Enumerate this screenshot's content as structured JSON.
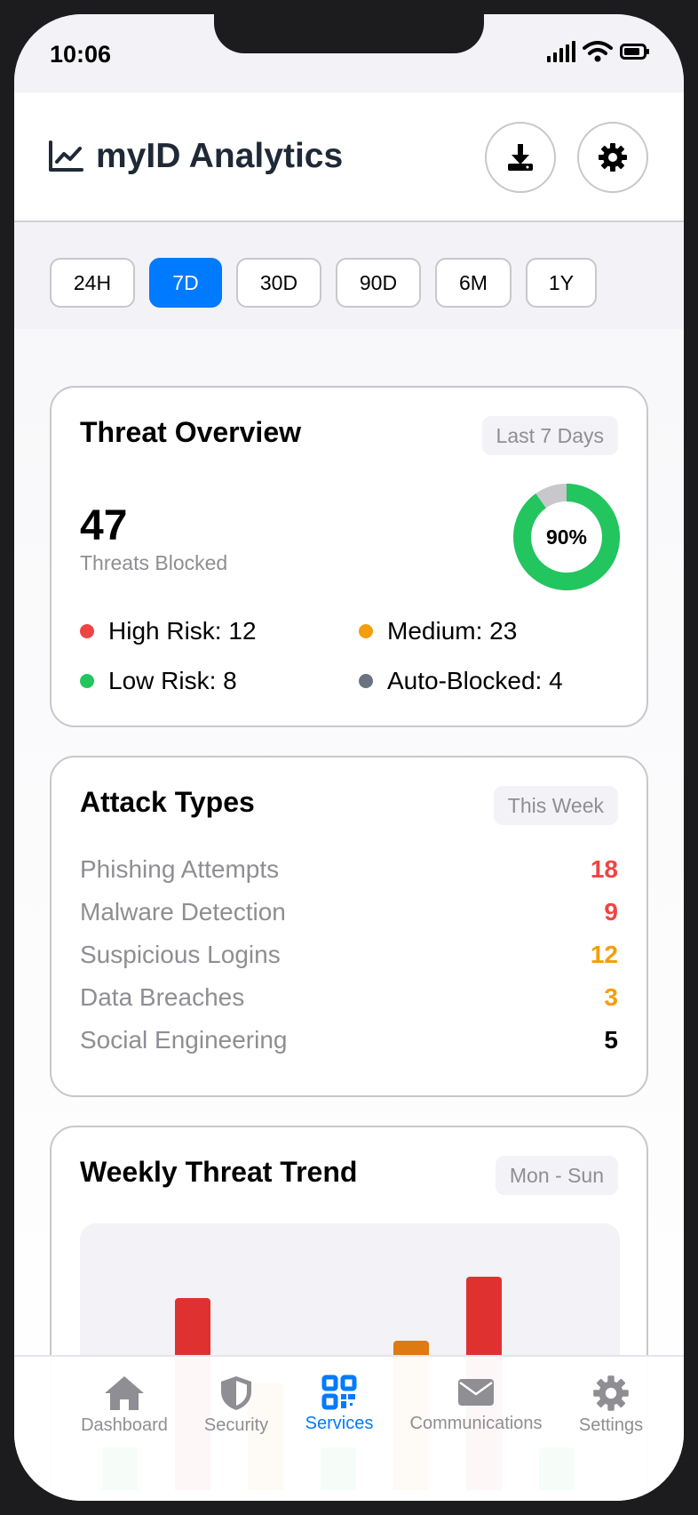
{
  "status_bar": {
    "time": "10:06"
  },
  "header": {
    "title": "myID Analytics"
  },
  "periods": [
    "24H",
    "7D",
    "30D",
    "90D",
    "6M",
    "1Y"
  ],
  "active_period": "7D",
  "threat_overview": {
    "title": "Threat Overview",
    "badge": "Last 7 Days",
    "count": "47",
    "count_label": "Threats Blocked",
    "percent_text": "90%",
    "percent_value": 0.9,
    "legend": [
      {
        "label": "High Risk: 12",
        "color": "#ef4444"
      },
      {
        "label": "Medium: 23",
        "color": "#f59e0b"
      },
      {
        "label": "Low Risk: 8",
        "color": "#22c55e"
      },
      {
        "label": "Auto-Blocked: 4",
        "color": "#6b7280"
      }
    ],
    "colors": {
      "ring": "#22c55e",
      "ring_track": "#c7c7cc"
    }
  },
  "attack_types": {
    "title": "Attack Types",
    "badge": "This Week",
    "rows": [
      {
        "label": "Phishing Attempts",
        "value": "18",
        "color": "#ef4444"
      },
      {
        "label": "Malware Detection",
        "value": "9",
        "color": "#ef4444"
      },
      {
        "label": "Suspicious Logins",
        "value": "12",
        "color": "#f59e0b"
      },
      {
        "label": "Data Breaches",
        "value": "3",
        "color": "#f59e0b"
      },
      {
        "label": "Social Engineering",
        "value": "5",
        "color": "#000000"
      }
    ]
  },
  "weekly_trend": {
    "title": "Weekly Threat Trend",
    "badge": "Mon - Sun"
  },
  "chart_data": {
    "type": "bar",
    "values": [
      2,
      9,
      5,
      2,
      7,
      10,
      2
    ],
    "colors": [
      "#22c55e",
      "#e03131",
      "#dd7a12",
      "#22c55e",
      "#dd7a12",
      "#e03131",
      "#22c55e"
    ]
  },
  "tabs": [
    {
      "label": "Dashboard",
      "icon": "home-icon"
    },
    {
      "label": "Security",
      "icon": "shield-icon"
    },
    {
      "label": "Services",
      "icon": "qr-code-icon"
    },
    {
      "label": "Communications",
      "icon": "envelope-icon"
    },
    {
      "label": "Settings",
      "icon": "gear-icon"
    }
  ],
  "active_tab": "Services"
}
